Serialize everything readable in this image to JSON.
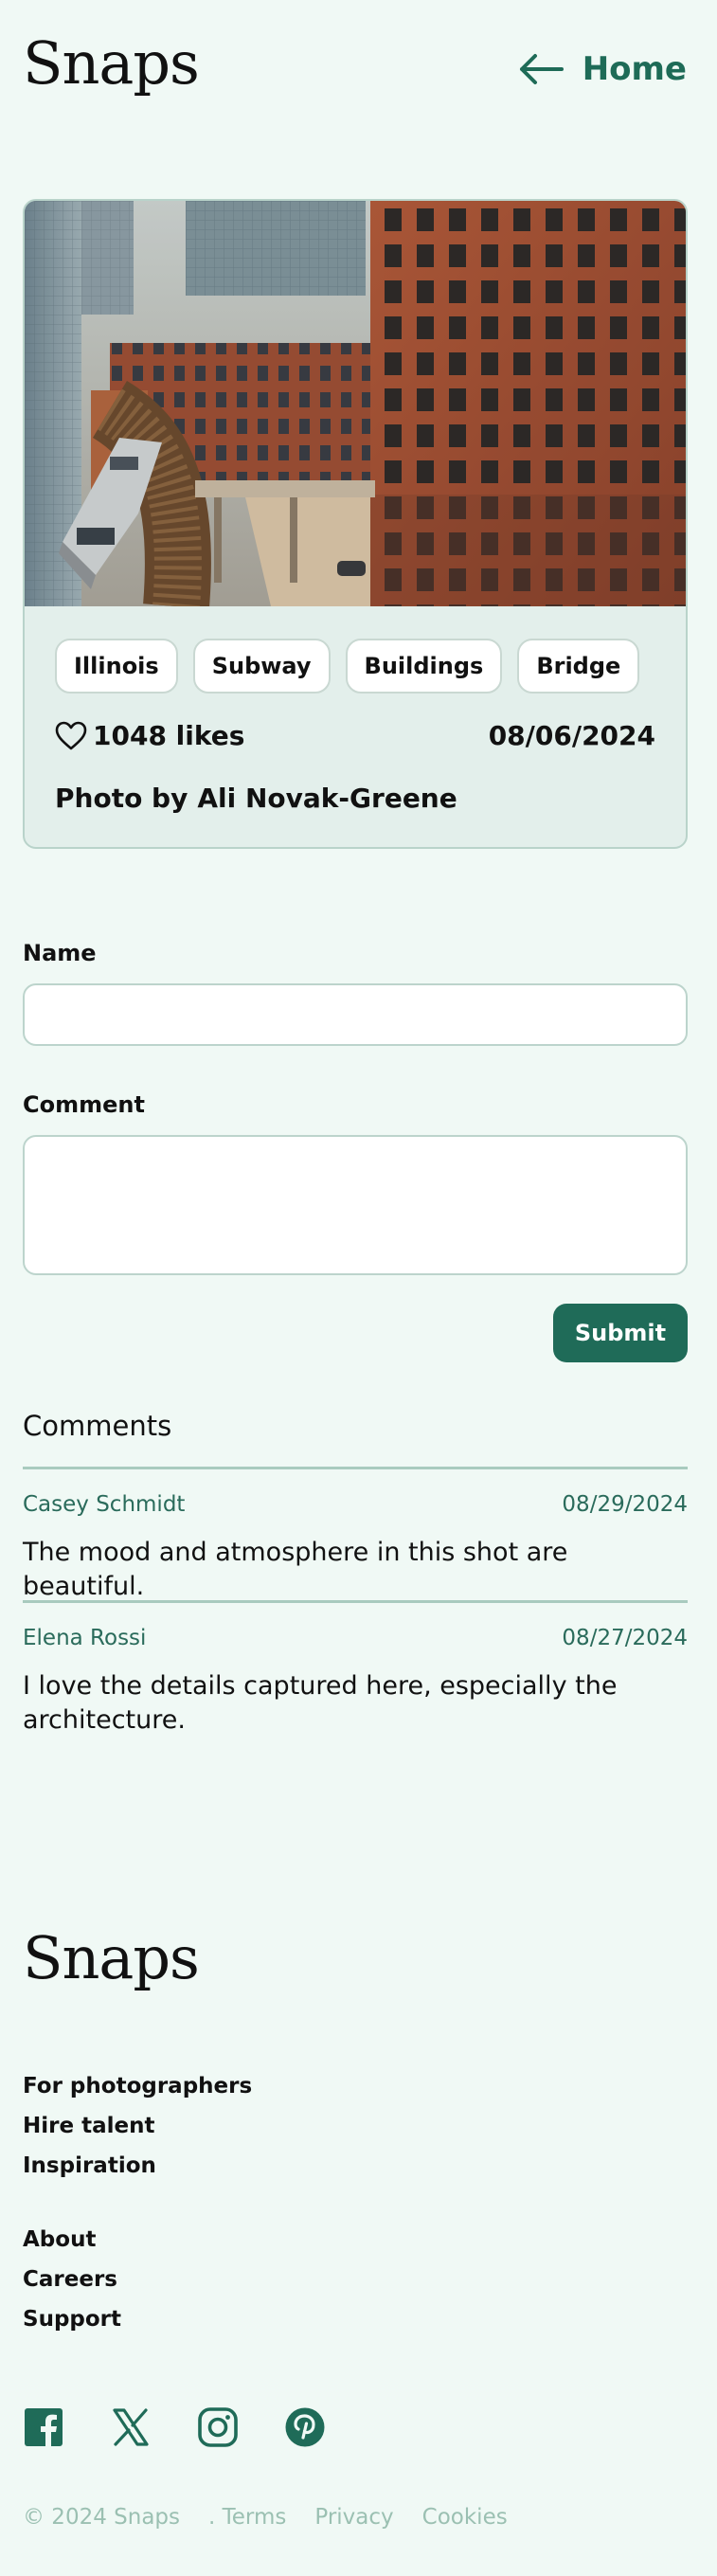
{
  "header": {
    "logo": "Snaps",
    "home_label": "Home"
  },
  "photo": {
    "tags": [
      "Illinois",
      "Subway",
      "Buildings",
      "Bridge"
    ],
    "likes": "1048 likes",
    "date": "08/06/2024",
    "credit_prefix": "Photo by",
    "photographer": "Ali Novak-Greene"
  },
  "form": {
    "name_label": "Name",
    "name_value": "",
    "comment_label": "Comment",
    "comment_value": "",
    "submit_label": "Submit"
  },
  "comments": {
    "title": "Comments",
    "items": [
      {
        "author": "Casey Schmidt",
        "date": "08/29/2024",
        "text": "The mood and atmosphere in this shot are beautiful."
      },
      {
        "author": "Elena Rossi",
        "date": "08/27/2024",
        "text": "I love the details captured here, especially the architecture."
      }
    ]
  },
  "footer": {
    "logo": "Snaps",
    "links_group_1": [
      "For photographers",
      "Hire talent",
      "Inspiration"
    ],
    "links_group_2": [
      "About",
      "Careers",
      "Support"
    ],
    "social_icons": [
      "facebook-icon",
      "x-icon",
      "instagram-icon",
      "pinterest-icon"
    ],
    "copyright": "© 2024 Snaps",
    "legal": [
      ". Terms",
      "Privacy",
      "Cookies"
    ]
  },
  "colors": {
    "background": "#f0f9f5",
    "accent": "#1f6b58",
    "card": "#e3efeb",
    "muted": "#9bc0b2"
  }
}
